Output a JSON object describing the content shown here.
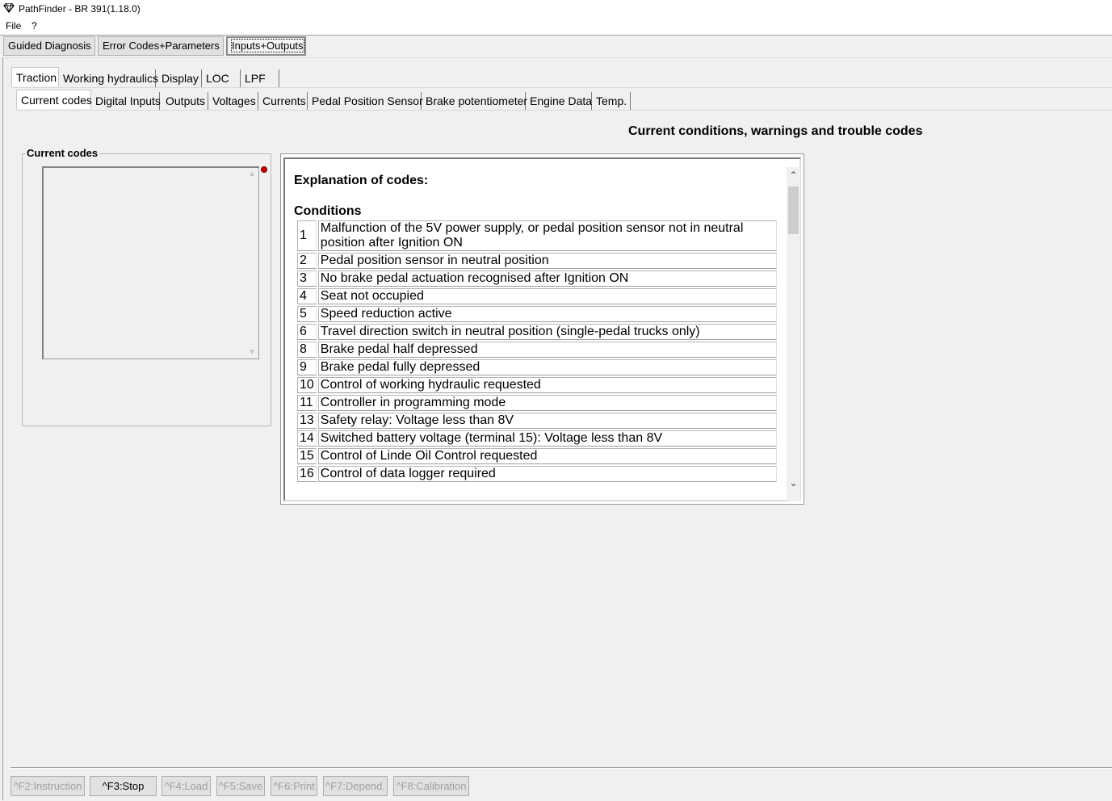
{
  "window": {
    "title": "PathFinder - BR 391(1.18.0)",
    "icon": "diamond-app-icon"
  },
  "menu": {
    "items": [
      "File",
      "?"
    ]
  },
  "main_tabs": [
    {
      "label": "Guided Diagnosis",
      "active": false
    },
    {
      "label": "Error Codes+Parameters",
      "active": false
    },
    {
      "label": "Inputs+Outputs",
      "active": true
    }
  ],
  "module_tabs": [
    {
      "label": "Traction",
      "active": true
    },
    {
      "label": "Working hydraulics",
      "active": false
    },
    {
      "label": "Display",
      "active": false
    },
    {
      "label": "LOC",
      "active": false
    },
    {
      "label": "LPF",
      "active": false
    }
  ],
  "sub_tabs": [
    {
      "label": "Current codes",
      "active": true
    },
    {
      "label": "Digital Inputs",
      "active": false
    },
    {
      "label": "Outputs",
      "active": false
    },
    {
      "label": "Voltages",
      "active": false
    },
    {
      "label": "Currents",
      "active": false
    },
    {
      "label": "Pedal Position Sensor",
      "active": false
    },
    {
      "label": "Brake potentiometer",
      "active": false
    },
    {
      "label": "Engine Data",
      "active": false
    },
    {
      "label": "Temp.",
      "active": false
    }
  ],
  "panel": {
    "title": "Current conditions, warnings and trouble codes",
    "current_codes_group_label": "Current codes",
    "status_indicator_color": "#c00000"
  },
  "explanation": {
    "heading": "Explanation of codes:",
    "section": "Conditions",
    "rows": [
      {
        "code": "1",
        "text": "Malfunction of the 5V power supply, or pedal position sensor not in neutral position after Ignition ON"
      },
      {
        "code": "2",
        "text": "Pedal position sensor in neutral position"
      },
      {
        "code": "3",
        "text": "No brake pedal actuation recognised after Ignition ON"
      },
      {
        "code": "4",
        "text": "Seat not occupied"
      },
      {
        "code": "5",
        "text": "Speed reduction active"
      },
      {
        "code": "6",
        "text": "Travel direction switch in neutral position (single-pedal trucks only)"
      },
      {
        "code": "8",
        "text": "Brake pedal half depressed"
      },
      {
        "code": "9",
        "text": "Brake pedal fully depressed"
      },
      {
        "code": "10",
        "text": "Control of working hydraulic requested"
      },
      {
        "code": "11",
        "text": "Controller in programming mode"
      },
      {
        "code": "13",
        "text": "Safety relay: Voltage less than 8V"
      },
      {
        "code": "14",
        "text": "Switched battery voltage (terminal 15): Voltage less than 8V"
      },
      {
        "code": "15",
        "text": "Control of Linde Oil Control requested"
      },
      {
        "code": "16",
        "text": "Control of data logger required"
      }
    ]
  },
  "function_keys": [
    {
      "label": "^F2:Instruction",
      "enabled": false
    },
    {
      "label": "^F3:Stop",
      "enabled": true
    },
    {
      "label": "^F4:Load",
      "enabled": false
    },
    {
      "label": "^F5:Save",
      "enabled": false
    },
    {
      "label": "^F6:Print",
      "enabled": false
    },
    {
      "label": "^F7:Depend.",
      "enabled": false
    },
    {
      "label": "^F8:Calibration",
      "enabled": false
    }
  ]
}
